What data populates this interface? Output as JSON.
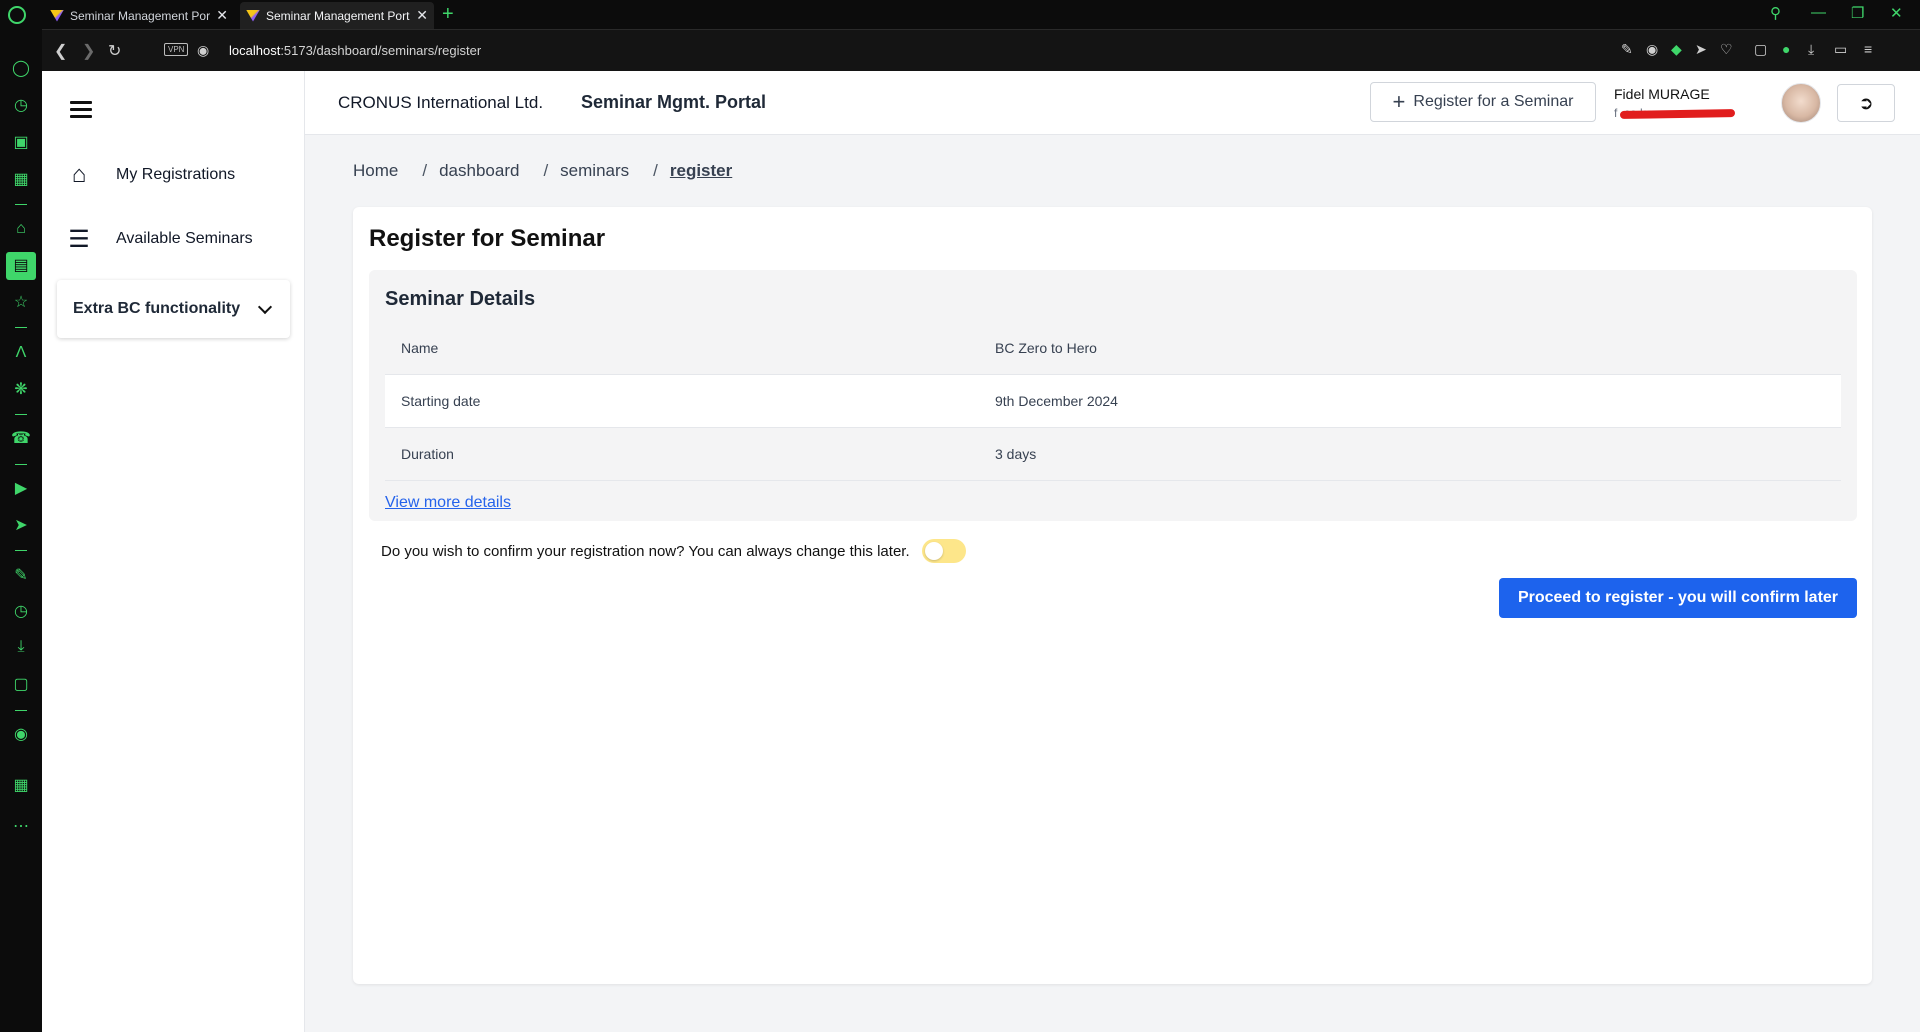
{
  "browser": {
    "tabs": [
      {
        "title": "Seminar Management Port",
        "close": "✕"
      },
      {
        "title": "Seminar Management Port",
        "close": "✕"
      }
    ],
    "new_tab": "+",
    "url_host": "localhost",
    "url_path": ":5173/dashboard/seminars/register",
    "vpn": "VPN"
  },
  "sidebar": {
    "items": [
      {
        "label": "My Registrations",
        "icon": "home-icon"
      },
      {
        "label": "Available Seminars",
        "icon": "list-icon"
      }
    ],
    "extra": {
      "label": "Extra BC functionality",
      "icon": "chevron-down-icon"
    }
  },
  "header": {
    "company": "CRONUS International Ltd.",
    "portal": "Seminar Mgmt. Portal",
    "register_button": "Register for a Seminar",
    "user_name": "Fidel MURAGE",
    "user_email": "f                              .co.ke"
  },
  "breadcrumb": [
    "Home",
    "dashboard",
    "seminars",
    "register"
  ],
  "breadcrumb_sep": "/",
  "page": {
    "title": "Register for Seminar",
    "details_title": "Seminar Details",
    "details": [
      {
        "key": "Name",
        "value": "BC Zero to Hero"
      },
      {
        "key": "Starting date",
        "value": "9th December 2024"
      },
      {
        "key": "Duration",
        "value": "3 days"
      }
    ],
    "more_link": "View more details",
    "confirm_question": "Do you wish to confirm your registration now? You can always change this later.",
    "confirm_toggle_on": false,
    "proceed_button": "Proceed to register - you will confirm later"
  },
  "colors": {
    "accent": "#1d63ed",
    "browser_green": "#3fd66a",
    "toggle_off": "#fde68a",
    "link": "#2563eb"
  }
}
